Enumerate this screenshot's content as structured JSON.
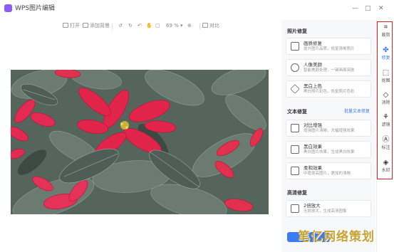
{
  "app": {
    "title": "WPS图片编辑"
  },
  "window": {
    "minimize": "—",
    "maximize": "□",
    "close": "✕"
  },
  "toolbar": {
    "open_label": "打开",
    "add_bg_label": "添加背景",
    "zoom": "69 %",
    "compare_label": "对比"
  },
  "panel": {
    "photo_repair": {
      "title": "照片修复",
      "items": [
        {
          "title": "画质修复",
          "desc": "提升图片品质，修复清晰照片"
        },
        {
          "title": "人像美颜",
          "desc": "智能美颜处理，一键画面亮肤"
        },
        {
          "title": "黑白上色",
          "desc": "黑白照片彩色，恢复照片色彩"
        }
      ]
    },
    "text_repair": {
      "title": "文本修复",
      "link": "批量文本修复",
      "items": [
        {
          "title": "对比增强",
          "desc": "增强图片清晰，大幅增强效果"
        },
        {
          "title": "黑白效果",
          "desc": "黑白图片效果，生成黑白效果"
        },
        {
          "title": "柔和效果",
          "desc": "中度提高图片，更加的清晰"
        }
      ]
    },
    "hd_repair": {
      "title": "高清修复",
      "items": [
        {
          "title": "2倍放大",
          "desc": "无损放大，生成高清图像"
        }
      ]
    }
  },
  "rail": {
    "items": [
      {
        "label": "裁剪",
        "icon": "crop-icon"
      },
      {
        "label": "修复",
        "icon": "repair-icon",
        "active": true
      },
      {
        "label": "抠图",
        "icon": "cutout-icon"
      },
      {
        "label": "消除",
        "icon": "eraser-icon"
      },
      {
        "label": "滤镜",
        "icon": "filter-icon"
      },
      {
        "label": "标注",
        "icon": "annotate-icon"
      },
      {
        "label": "水印",
        "icon": "watermark-icon"
      }
    ]
  },
  "watermark_text": "笔亿网络策划",
  "colors": {
    "accent": "#3b7cf5",
    "highlight_frame": "#e02020"
  }
}
